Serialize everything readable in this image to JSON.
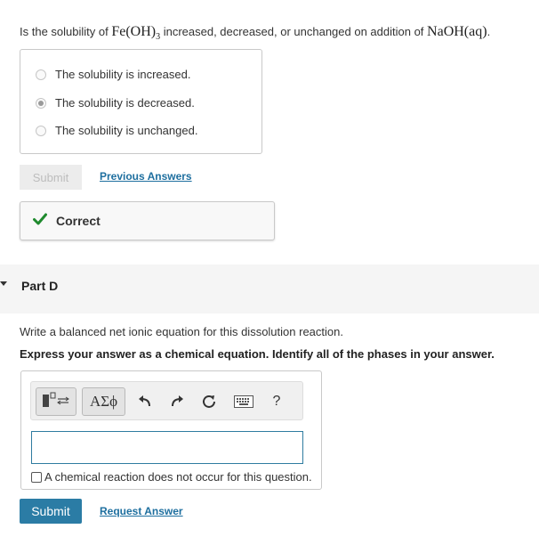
{
  "question": {
    "prefix": "Is the solubility of ",
    "formula_main": "Fe(OH)",
    "formula_sub": "3",
    "middle": " increased, decreased, or unchanged on addition of ",
    "reagent": "NaOH(aq)",
    "suffix": "."
  },
  "choices": [
    {
      "label": "The solubility is increased.",
      "selected": false
    },
    {
      "label": "The solubility is decreased.",
      "selected": true
    },
    {
      "label": "The solubility is unchanged.",
      "selected": false
    }
  ],
  "part_c_actions": {
    "submit_label": "Submit",
    "previous_answers_label": "Previous Answers"
  },
  "feedback": {
    "text": "Correct",
    "color": "#1f8a2e"
  },
  "part_d": {
    "title": "Part D",
    "instruction": "Write a balanced net ionic equation for this dissolution reaction.",
    "bold_instruction": "Express your answer as a chemical equation. Identify all of the phases in your answer."
  },
  "toolbar": {
    "greek_label": "ΑΣϕ",
    "help_label": "?",
    "icons": [
      "template-icon",
      "undo-icon",
      "redo-icon",
      "reset-icon",
      "keyboard-icon",
      "help-icon"
    ]
  },
  "answer": {
    "value": "",
    "no_reaction_label": "A chemical reaction does not occur for this question."
  },
  "part_d_actions": {
    "submit_label": "Submit",
    "request_answer_label": "Request Answer"
  },
  "colors": {
    "accent": "#2b7ca5",
    "link": "#1e6f9f"
  }
}
